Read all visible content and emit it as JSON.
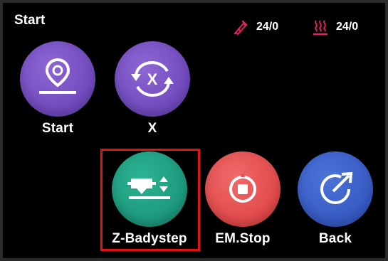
{
  "header": {
    "title": "Start"
  },
  "status": {
    "nozzle_temp": "24/0",
    "bed_temp": "24/0",
    "accent_color": "#e0245e"
  },
  "buttons": [
    {
      "label": "Start",
      "icon": "start-pin-icon",
      "color": "#7a55c8"
    },
    {
      "label": "X",
      "icon": "x-rotate-icon",
      "color": "#7a55c8"
    },
    {
      "label": "Z-Badystep",
      "icon": "z-babystep-icon",
      "color": "#22a584",
      "highlighted": true
    },
    {
      "label": "EM.Stop",
      "icon": "stop-icon",
      "color": "#e85252"
    },
    {
      "label": "Back",
      "icon": "back-arrow-icon",
      "color": "#4366cd"
    }
  ],
  "highlight_color": "#e01414"
}
